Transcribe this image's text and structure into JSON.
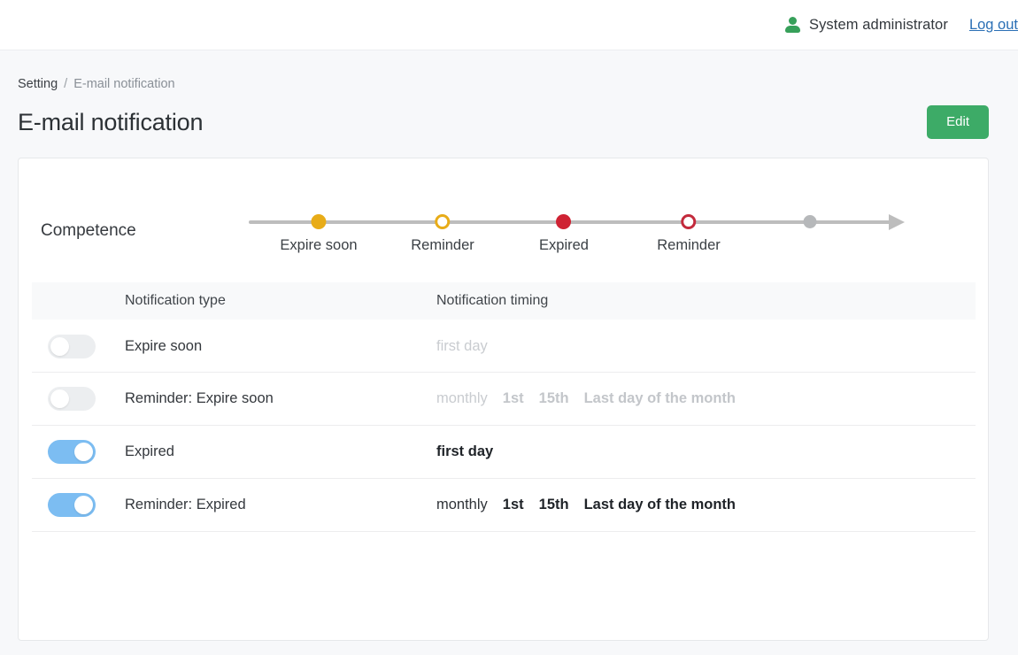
{
  "topbar": {
    "person_icon": "person-icon",
    "user_name": "System administrator",
    "logout_label": "Log out"
  },
  "breadcrumb": {
    "root": "Setting",
    "separator": "/",
    "current": "E-mail notification"
  },
  "page": {
    "title": "E-mail notification",
    "edit_label": "Edit"
  },
  "timeline": {
    "label": "Competence",
    "nodes": [
      {
        "caption": "Expire soon",
        "style": "filled-amber",
        "pos": 79
      },
      {
        "caption": "Reminder",
        "style": "hollow-amber",
        "pos": 219
      },
      {
        "caption": "Expired",
        "style": "filled-red",
        "pos": 356
      },
      {
        "caption": "Reminder",
        "style": "hollow-red",
        "pos": 497
      },
      {
        "caption": "",
        "style": "filled-grey",
        "pos": 634
      }
    ]
  },
  "table": {
    "headers": {
      "type": "Notification type",
      "timing": "Notification timing"
    },
    "rows": [
      {
        "enabled": false,
        "toggle_state": "off",
        "type": "Expire soon",
        "timing": [
          {
            "text": "first day",
            "weight": "firstday-inactive"
          }
        ]
      },
      {
        "enabled": false,
        "toggle_state": "off",
        "type": "Reminder: Expire soon",
        "timing": [
          {
            "text": "monthly",
            "weight": "normal"
          },
          {
            "text": "1st",
            "weight": "bold"
          },
          {
            "text": "15th",
            "weight": "bold"
          },
          {
            "text": "Last day of the month",
            "weight": "bold"
          }
        ]
      },
      {
        "enabled": true,
        "toggle_state": "on",
        "type": "Expired",
        "timing": [
          {
            "text": "first day",
            "weight": "firstday-active"
          }
        ]
      },
      {
        "enabled": true,
        "toggle_state": "on",
        "type": "Reminder: Expired",
        "timing": [
          {
            "text": "monthly",
            "weight": "normal"
          },
          {
            "text": "1st",
            "weight": "bold"
          },
          {
            "text": "15th",
            "weight": "bold"
          },
          {
            "text": "Last day of the month",
            "weight": "bold"
          }
        ]
      }
    ]
  },
  "colors": {
    "accent_green": "#3dab67",
    "link_blue": "#2a6fb5",
    "toggle_on": "#7cbdf2",
    "toggle_off": "#eceef0",
    "amber": "#e8ac18",
    "red": "#cf2233",
    "grey": "#b6b8ba",
    "page_bg": "#f7f8fa"
  }
}
